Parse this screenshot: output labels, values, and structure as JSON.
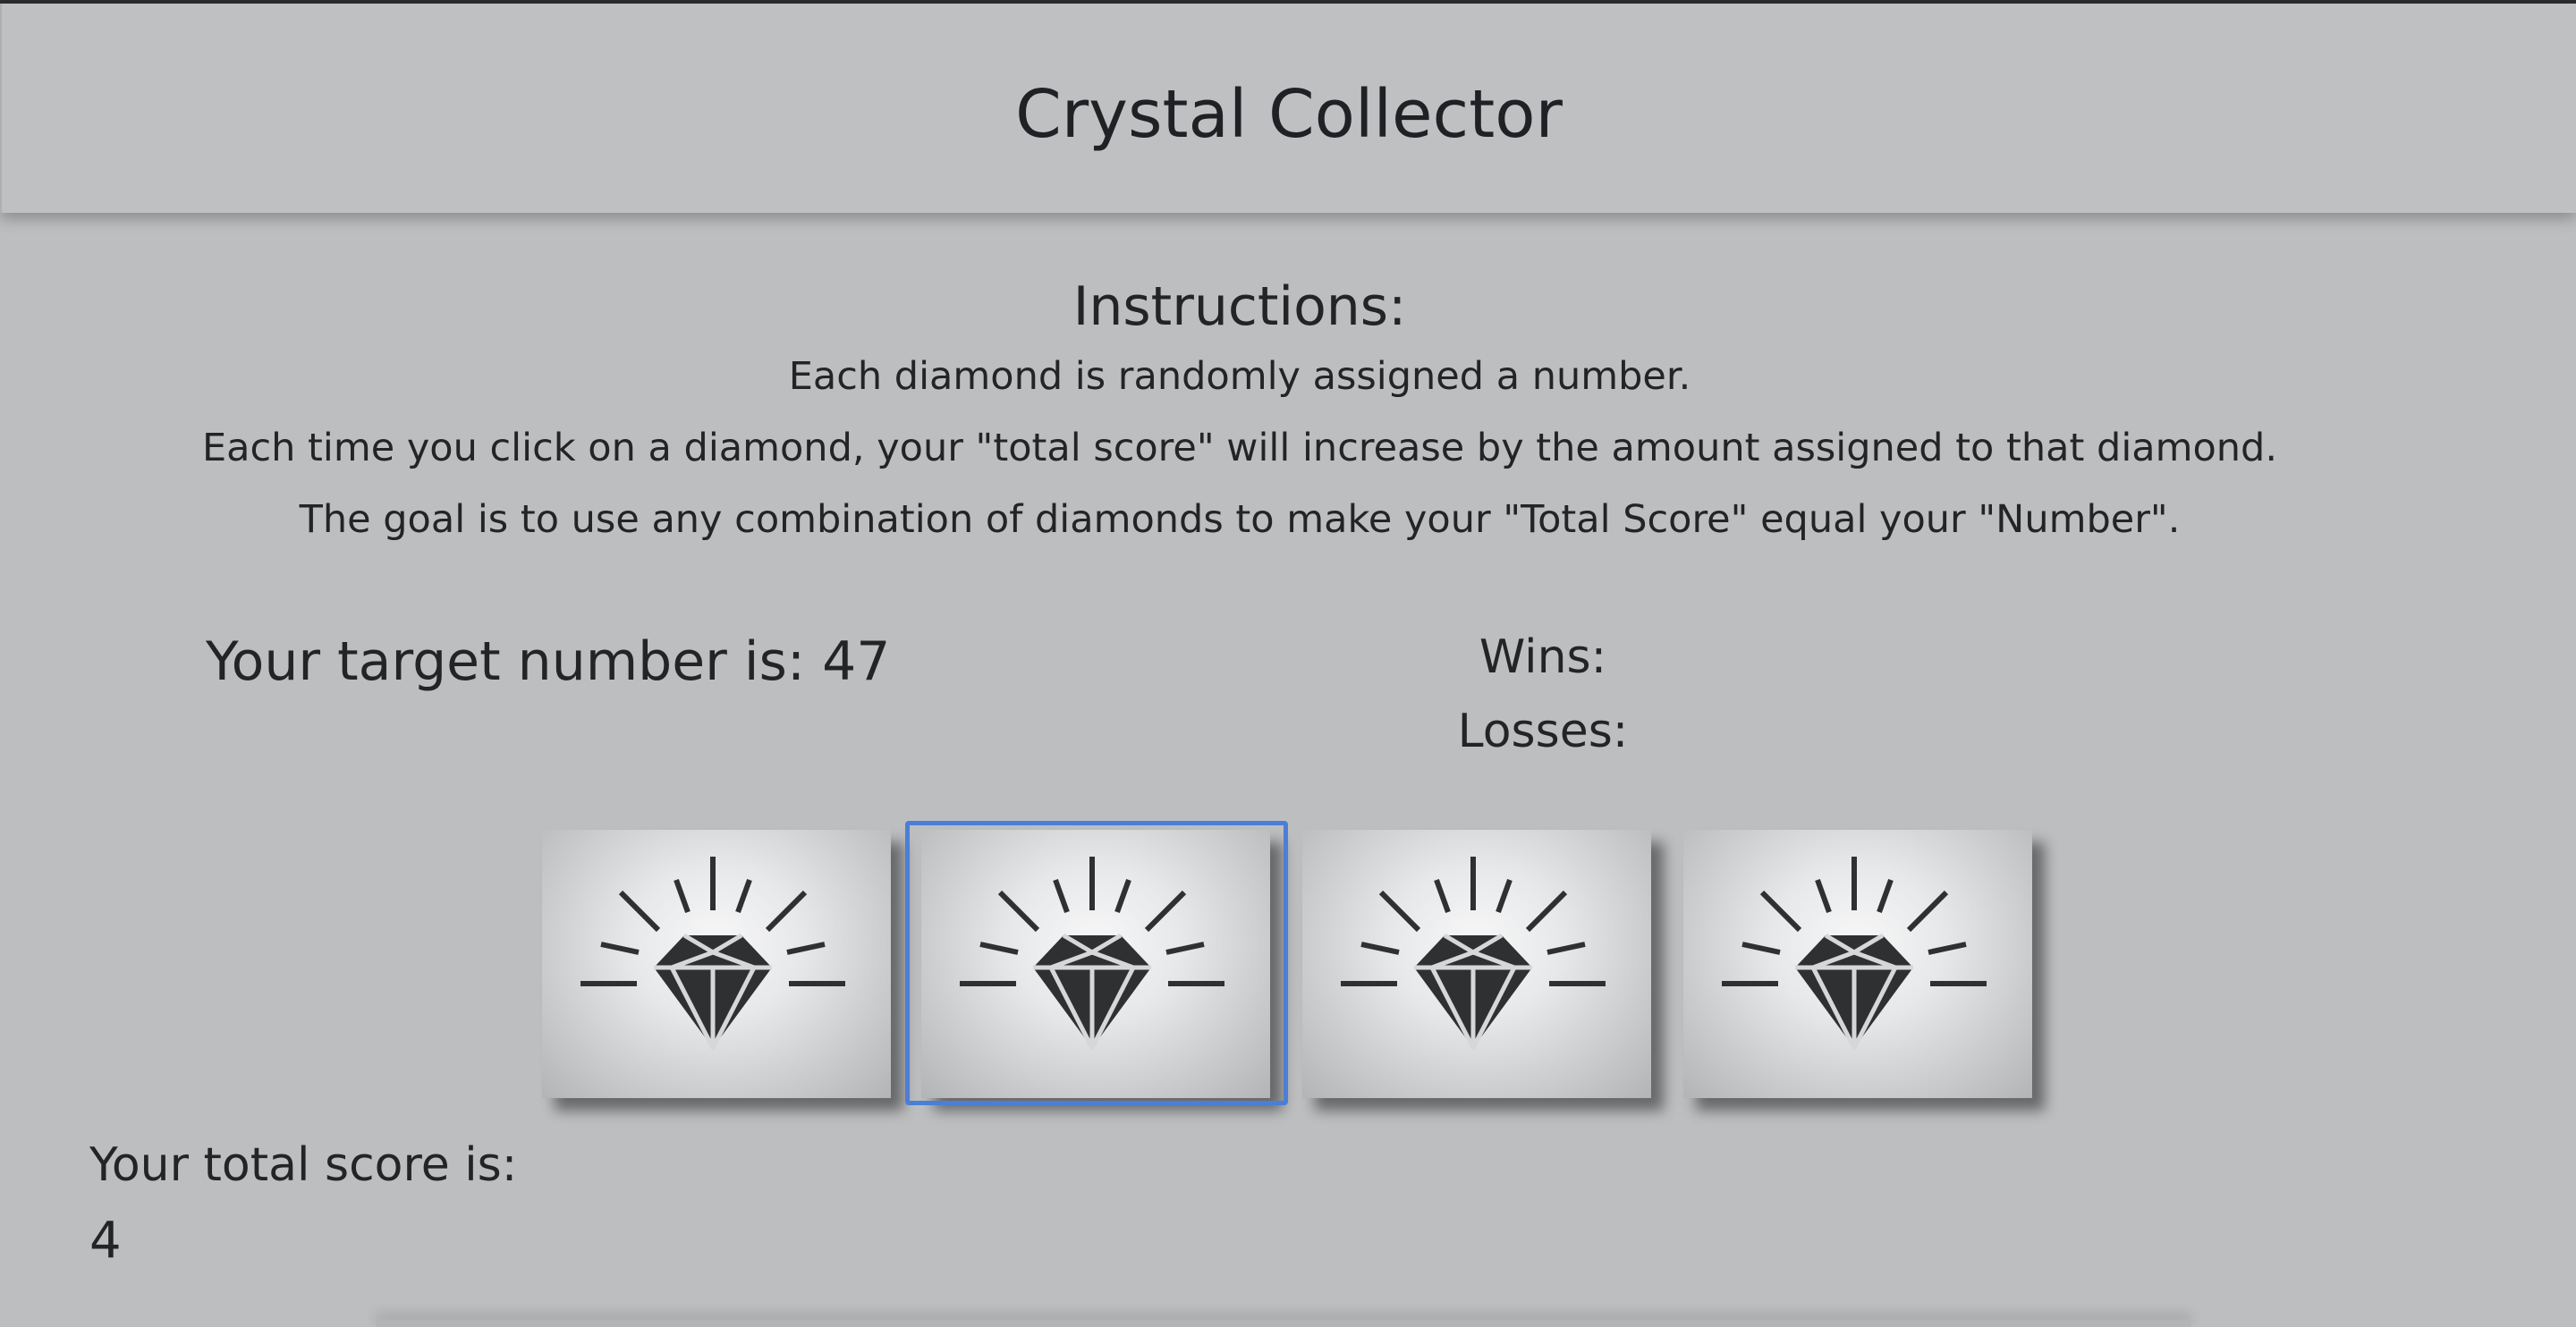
{
  "header": {
    "title": "Crystal Collector"
  },
  "instructions": {
    "heading": "Instructions:",
    "lines": [
      "Each diamond is randomly assigned a number.",
      "Each time you click on a diamond, your \"total score\" will increase by the amount assigned to that diamond.",
      "The goal is to use any combination of diamonds to make your \"Total Score\" equal your \"Number\"."
    ]
  },
  "target": {
    "label": "Your target number is: 47"
  },
  "stats": {
    "wins_label": "Wins:",
    "losses_label": "Losses:"
  },
  "crystals": [
    {
      "icon": "diamond-icon"
    },
    {
      "icon": "diamond-icon"
    },
    {
      "icon": "diamond-icon"
    },
    {
      "icon": "diamond-icon"
    }
  ],
  "score": {
    "label": "Your total score is:",
    "value": "4"
  },
  "colors": {
    "background": "#bdbec0",
    "header_background": "#bfc0c2",
    "text": "#222426",
    "diamond": "#2f3032",
    "focus_outline": "#4b7fd6"
  }
}
